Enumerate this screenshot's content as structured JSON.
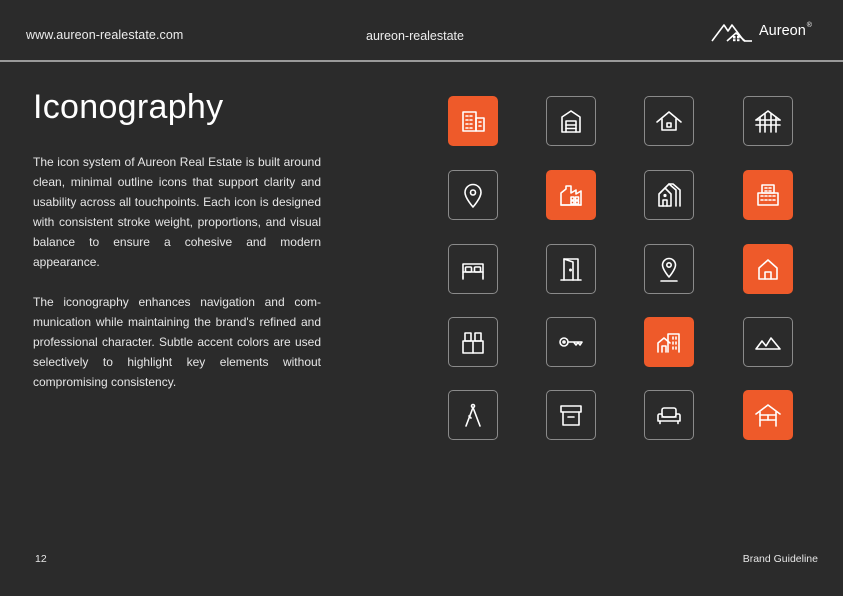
{
  "header": {
    "url": "www.aureon-realestate.com",
    "center": "aureon-realestate",
    "brand_name": "Aureon",
    "brand_mark": "®"
  },
  "title": "Iconography",
  "paragraphs": [
    "The icon system of Aureon Real Estate is built around clean, minimal outline icons that support clarity and usability across all touchpoints. Each icon is designed with consistent stroke weight, proportions, and visual balance to ensure a cohe­sive and modern appearance.",
    "The iconography enhances navigation and com­munication while maintaining the brand's refined and professional character. Subtle accent colors are used selectively to highlight key elements with­out compromising consistency."
  ],
  "footer": {
    "page_number": "12",
    "label": "Brand Guideline"
  },
  "colors": {
    "background": "#2b2b2b",
    "accent": "#ee5a2a",
    "tile_border": "#8a8a8a",
    "text": "#ffffff"
  },
  "icons": [
    {
      "name": "office-building-icon",
      "filled": true
    },
    {
      "name": "garage-icon",
      "filled": false
    },
    {
      "name": "house-roof-icon",
      "filled": false
    },
    {
      "name": "roof-frame-icon",
      "filled": false
    },
    {
      "name": "location-pin-icon",
      "filled": false
    },
    {
      "name": "factory-icon",
      "filled": true
    },
    {
      "name": "houses-row-icon",
      "filled": false
    },
    {
      "name": "apartment-block-icon",
      "filled": true
    },
    {
      "name": "bed-icon",
      "filled": false
    },
    {
      "name": "door-icon",
      "filled": false
    },
    {
      "name": "map-pin-base-icon",
      "filled": false
    },
    {
      "name": "home-icon",
      "filled": true
    },
    {
      "name": "gift-box-icon",
      "filled": false
    },
    {
      "name": "key-icon",
      "filled": false
    },
    {
      "name": "home-building-icon",
      "filled": true
    },
    {
      "name": "mountains-icon",
      "filled": false
    },
    {
      "name": "compass-icon",
      "filled": false
    },
    {
      "name": "archive-box-icon",
      "filled": false
    },
    {
      "name": "sofa-icon",
      "filled": false
    },
    {
      "name": "shelter-icon",
      "filled": true
    }
  ]
}
